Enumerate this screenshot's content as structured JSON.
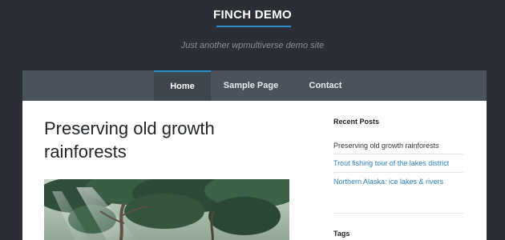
{
  "site": {
    "title": "FINCH DEMO",
    "tagline": "Just another wpmultiverse demo site",
    "accent_color": "#2a8fd1"
  },
  "nav": {
    "items": [
      {
        "label": "Home",
        "active": true
      },
      {
        "label": "Sample Page",
        "active": false
      },
      {
        "label": "Contact",
        "active": false
      }
    ]
  },
  "post": {
    "title": "Preserving old growth rainforests",
    "image": "forest-photo"
  },
  "sidebar": {
    "recent_posts_title": "Recent Posts",
    "recent_posts": [
      {
        "label": "Preserving old growth rainforests",
        "color": "#333333"
      },
      {
        "label": "Trout fishing tour of the lakes district",
        "color": "#2a7fc0"
      },
      {
        "label": "Northern Alaska: ice lakes & rivers",
        "color": "#2a7fc0"
      }
    ],
    "tags_title": "Tags"
  }
}
